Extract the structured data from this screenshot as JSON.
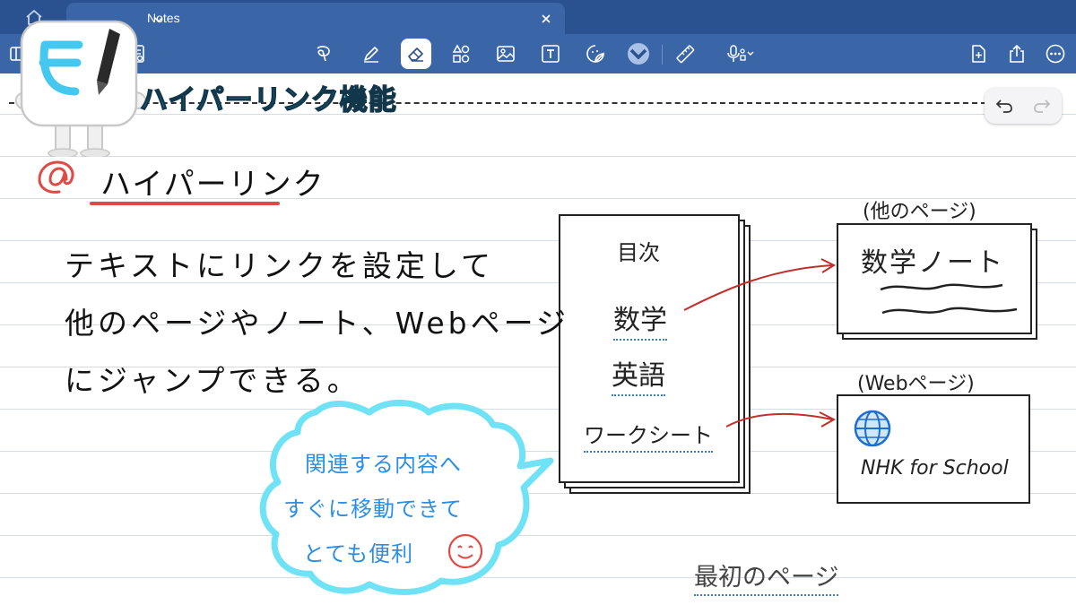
{
  "app": {
    "tab_title": "Notes",
    "accent_color": "#3a66a8",
    "tabbar_color": "#2a5290"
  },
  "toolbar": {
    "left_tools": [
      "sidebar-icon",
      "notebook-icon",
      "page-list-icon"
    ],
    "center_tools": [
      "lasso-icon",
      "pen-icon",
      "eraser-icon",
      "shapes-icon",
      "image-icon",
      "textbox-icon",
      "sticker-icon",
      "more-tools-icon",
      "ruler-icon",
      "microphone-icon"
    ],
    "active_tool": "eraser-icon",
    "right_tools": [
      "add-page-icon",
      "share-icon",
      "more-options-icon"
    ]
  },
  "page": {
    "section_title": "ハイパーリンク機能",
    "heading": "ハイパーリンク",
    "body_lines": [
      "テキストにリンクを設定して",
      "他のページやノート、Webページ",
      "にジャンプできる。"
    ],
    "bubble_lines": [
      "関連する内容へ",
      "すぐに移動できて",
      "とても便利"
    ],
    "toc": {
      "title": "目次",
      "items": [
        "数学",
        "英語",
        "ワークシート"
      ]
    },
    "other_page": {
      "caption": "(他のページ)",
      "title": "数学ノート"
    },
    "web_page": {
      "caption": "(Webページ)",
      "title": "NHK for School"
    },
    "first_page_label": "最初のページ",
    "colors": {
      "title_cyan": "#2fd0f2",
      "underline_red": "#e04a45",
      "bubble_blue": "#2b8fe6",
      "arrow_red": "#c0302a",
      "link_blue": "#3c7cc8"
    }
  }
}
